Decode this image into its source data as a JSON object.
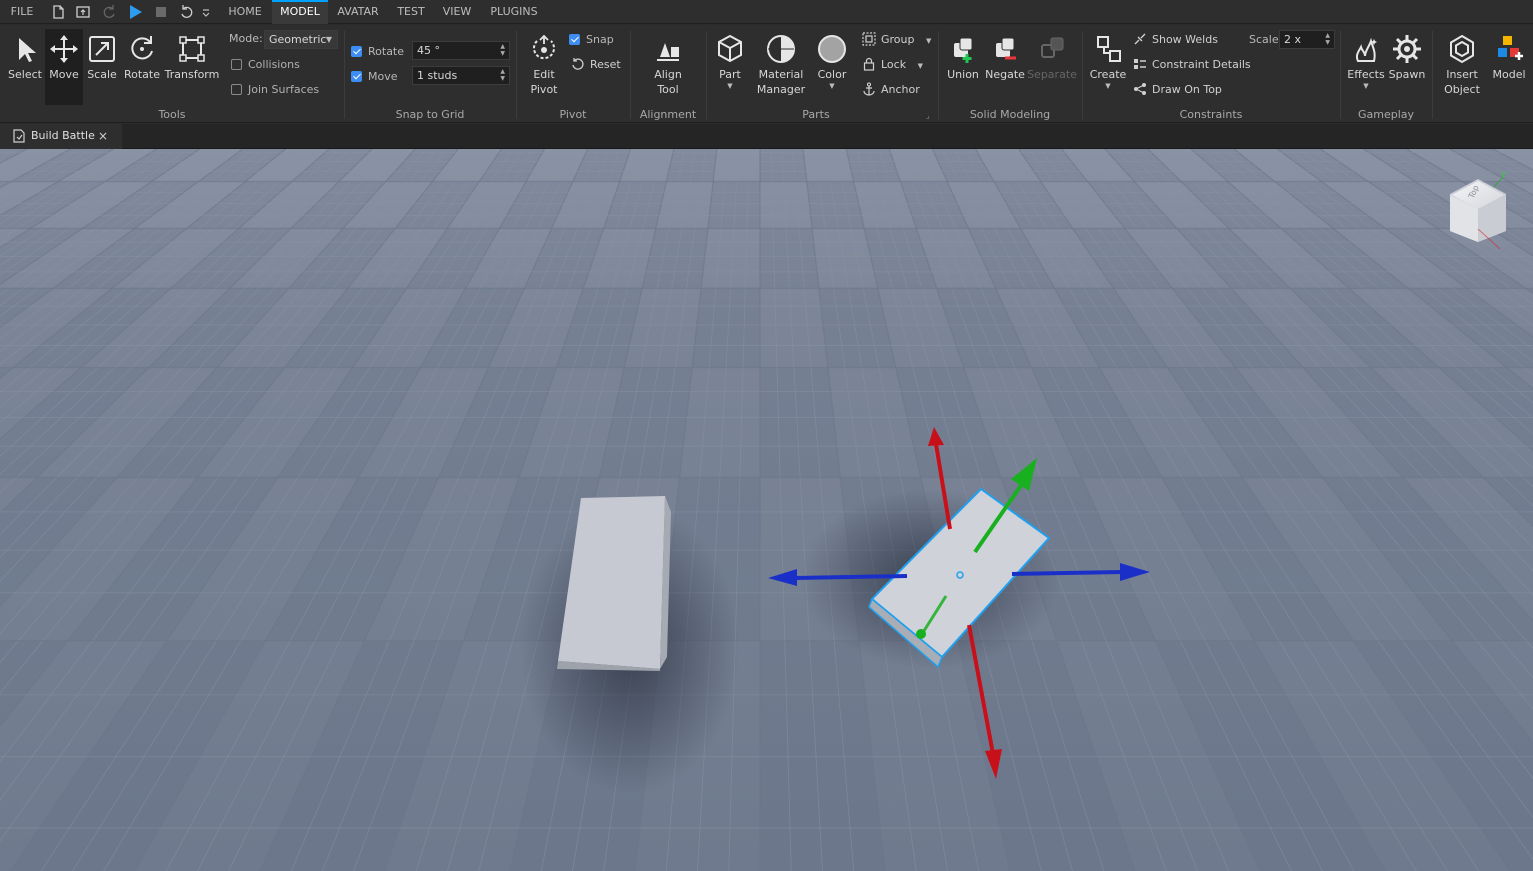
{
  "menu": {
    "file": "FILE",
    "tabs": [
      "HOME",
      "MODEL",
      "AVATAR",
      "TEST",
      "VIEW",
      "PLUGINS"
    ],
    "active_tab": "MODEL"
  },
  "tools": {
    "group_label": "Tools",
    "buttons": [
      "Select",
      "Move",
      "Scale",
      "Rotate",
      "Transform"
    ],
    "active": "Move",
    "mode_label": "Mode:",
    "mode_value": "Geometric",
    "collisions": "Collisions",
    "join_surfaces": "Join Surfaces"
  },
  "snap": {
    "group_label": "Snap to Grid",
    "rotate_label": "Rotate",
    "rotate_value": "45 °",
    "move_label": "Move",
    "move_value": "1 studs"
  },
  "pivot": {
    "group_label": "Pivot",
    "edit_line1": "Edit",
    "edit_line2": "Pivot",
    "snap": "Snap",
    "reset": "Reset"
  },
  "alignment": {
    "group_label": "Alignment",
    "align_line1": "Align",
    "align_line2": "Tool"
  },
  "parts": {
    "group_label": "Parts",
    "part": "Part",
    "material_line1": "Material",
    "material_line2": "Manager",
    "color": "Color",
    "group": "Group",
    "lock": "Lock",
    "anchor": "Anchor"
  },
  "solid_modeling": {
    "group_label": "Solid Modeling",
    "union": "Union",
    "negate": "Negate",
    "separate": "Separate"
  },
  "constraints": {
    "group_label": "Constraints",
    "create": "Create",
    "show_welds": "Show Welds",
    "constraint_details": "Constraint Details",
    "draw_on_top": "Draw On Top",
    "scale_label": "Scale",
    "scale_value": "2 x"
  },
  "gameplay": {
    "group_label": "Gameplay",
    "effects": "Effects",
    "spawn": "Spawn"
  },
  "insert": {
    "insert_line1": "Insert",
    "insert_line2": "Object",
    "model": "Model"
  },
  "document_tab": {
    "title": "Build Battle",
    "close": "×"
  },
  "view_cube": {
    "face": "Top",
    "axis_y": "Y"
  },
  "colors": {
    "ribbon_bg": "#2e2e2e",
    "accent": "#00a2ff",
    "checkbox": "#3d8df5",
    "baseplate": "#7a8497",
    "gizmo_x": "#c8101b",
    "gizmo_y": "#19b01f",
    "gizmo_z": "#1a2fc8",
    "selection": "#1ea0f0"
  }
}
